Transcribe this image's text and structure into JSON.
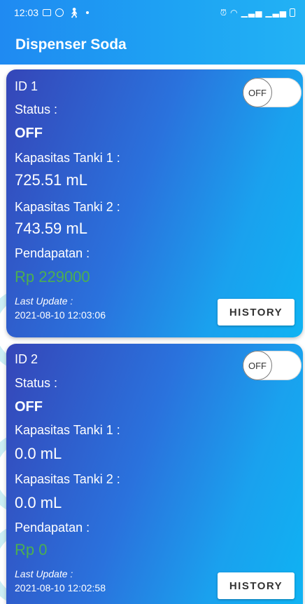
{
  "status_bar": {
    "time": "12:03",
    "left_icons": [
      "gallery-icon",
      "whatsapp-icon",
      "accessibility-icon",
      "dot-icon"
    ],
    "right_icons": [
      "alarm-icon",
      "wifi-icon",
      "signal-icon",
      "signal-icon",
      "battery-icon"
    ]
  },
  "app": {
    "title": "Dispenser Soda"
  },
  "colors": {
    "header": "#1ea4f3",
    "card_start": "#3546b8",
    "card_end": "#0fb3f3",
    "money": "#4caf50"
  },
  "devices": [
    {
      "id_label": "ID 1",
      "toggle_label": "OFF",
      "status_label": "Status :",
      "status_value": "OFF",
      "tank1_label": "Kapasitas Tanki 1 :",
      "tank1_value": "725.51 mL",
      "tank2_label": "Kapasitas Tanki 2 :",
      "tank2_value": "743.59 mL",
      "income_label": "Pendapatan :",
      "income_value": "Rp 229000",
      "last_update_label": "Last Update :",
      "last_update_value": "2021-08-10 12:03:06",
      "history_label": "HISTORY"
    },
    {
      "id_label": "ID 2",
      "toggle_label": "OFF",
      "status_label": "Status :",
      "status_value": "OFF",
      "tank1_label": "Kapasitas Tanki 1 :",
      "tank1_value": "0.0 mL",
      "tank2_label": "Kapasitas Tanki 2 :",
      "tank2_value": "0.0 mL",
      "income_label": "Pendapatan :",
      "income_value": "Rp 0",
      "last_update_label": "Last Update :",
      "last_update_value": "2021-08-10 12:02:58",
      "history_label": "HISTORY"
    }
  ]
}
